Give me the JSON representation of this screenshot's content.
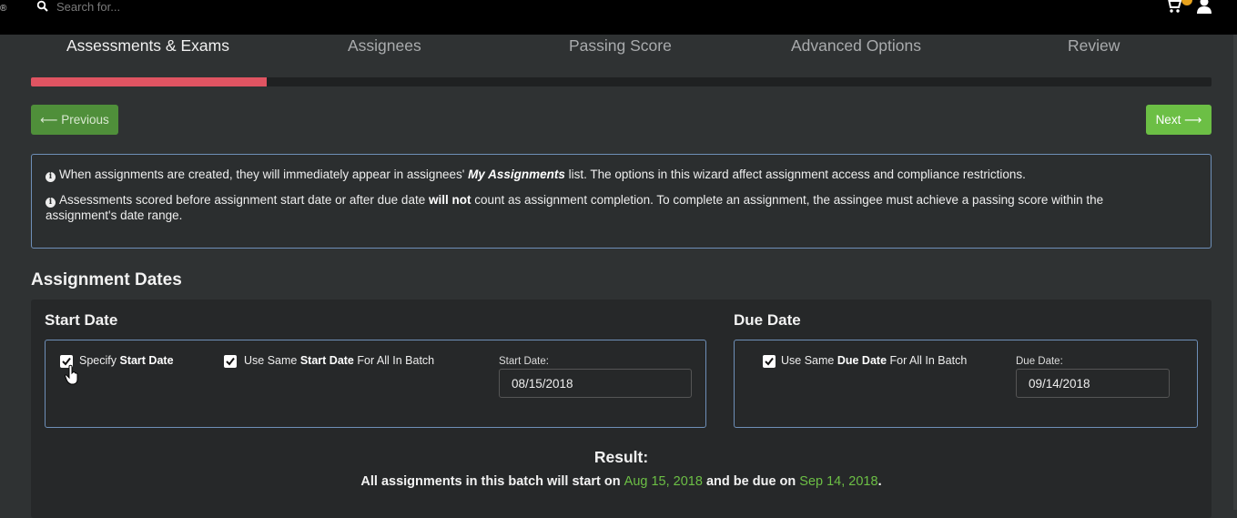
{
  "header": {
    "search": {
      "placeholder": "Search for..."
    }
  },
  "steps": [
    {
      "label": "Assessments & Exams",
      "active": true
    },
    {
      "label": "Assignees",
      "active": false
    },
    {
      "label": "Passing Score",
      "active": false
    },
    {
      "label": "Advanced Options",
      "active": false
    },
    {
      "label": "Review",
      "active": false
    }
  ],
  "progress": {
    "percent": 20
  },
  "nav": {
    "previous_label": "⟵ Previous",
    "next_label": "Next ⟶"
  },
  "info": {
    "line1": {
      "before": "When assignments are created, they will immediately appear in assignees'",
      "emphasis": "My Assignments",
      "after": "list. The options in this wizard affect assignment access and compliance restrictions."
    },
    "line2": {
      "before": "Assessments scored before assignment start date or after due date",
      "emphasis": "will not",
      "after": "count as assignment completion. To complete an assignment, the assingee must achieve a passing score within the",
      "continuation": "assignment's date range."
    }
  },
  "assignment_dates": {
    "title": "Assignment Dates",
    "start": {
      "title": "Start Date",
      "specify": {
        "prefix": "Specify",
        "bold": "Start Date",
        "checked": true
      },
      "same_for_batch": {
        "prefix": "Use Same",
        "bold": "Start Date",
        "suffix": "For All In Batch",
        "checked": true
      },
      "date_label": "Start Date:",
      "date_value": "08/15/2018"
    },
    "due": {
      "title": "Due Date",
      "same_for_batch": {
        "prefix": "Use Same",
        "bold": "Due Date",
        "suffix": "For All In Batch",
        "checked": true
      },
      "date_label": "Due Date:",
      "date_value": "09/14/2018"
    }
  },
  "result": {
    "title": "Result:",
    "text_before": "All assignments in this batch will start on",
    "start_date": "Aug 15, 2018",
    "text_middle": "and be due on",
    "due_date": "Sep 14, 2018",
    "text_end": "."
  },
  "colors": {
    "accent_green": "#6cbf45",
    "progress_red": "#e05462",
    "box_border": "#6e8fb8"
  }
}
